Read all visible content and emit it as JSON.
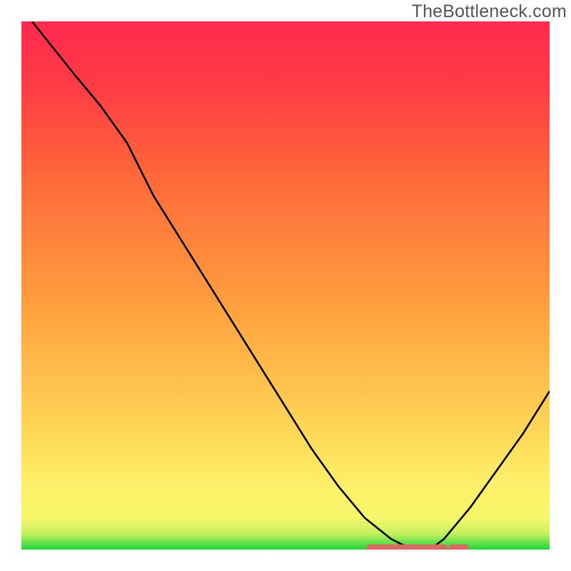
{
  "watermark": "TheBottleneck.com",
  "chart_data": {
    "type": "line",
    "title": "",
    "xlabel": "",
    "ylabel": "",
    "xlim": [
      0,
      100
    ],
    "ylim": [
      0,
      100
    ],
    "grid": false,
    "legend": false,
    "description": "V-shaped bottleneck curve over a vertical green-to-red gradient background; minimum near x≈75 sitting on a thin bright-green band at the bottom.",
    "series": [
      {
        "name": "bottleneck-curve",
        "x": [
          2,
          10,
          15,
          20,
          25,
          30,
          35,
          40,
          45,
          50,
          55,
          60,
          65,
          70,
          73,
          75,
          78,
          80,
          85,
          90,
          95,
          100
        ],
        "y": [
          100,
          90,
          84,
          77,
          67,
          59,
          51,
          43,
          35,
          27,
          19,
          12,
          6,
          2,
          0.5,
          0,
          0.5,
          2,
          8,
          15,
          22,
          30
        ]
      }
    ],
    "marker_band": {
      "name": "optimal-range",
      "x_start": 66,
      "x_end": 84,
      "y": 0.3,
      "color": "#d96a62"
    },
    "background_gradient": {
      "stops": [
        {
          "pos": 0.0,
          "color": "#23d33a"
        },
        {
          "pos": 0.015,
          "color": "#6fe24e"
        },
        {
          "pos": 0.03,
          "color": "#c6f05f"
        },
        {
          "pos": 0.06,
          "color": "#f6f66b"
        },
        {
          "pos": 0.12,
          "color": "#fff06a"
        },
        {
          "pos": 0.25,
          "color": "#ffd154"
        },
        {
          "pos": 0.45,
          "color": "#ffa23f"
        },
        {
          "pos": 0.7,
          "color": "#ff6a3a"
        },
        {
          "pos": 0.88,
          "color": "#ff3a44"
        },
        {
          "pos": 1.0,
          "color": "#ff2a50"
        }
      ]
    }
  }
}
